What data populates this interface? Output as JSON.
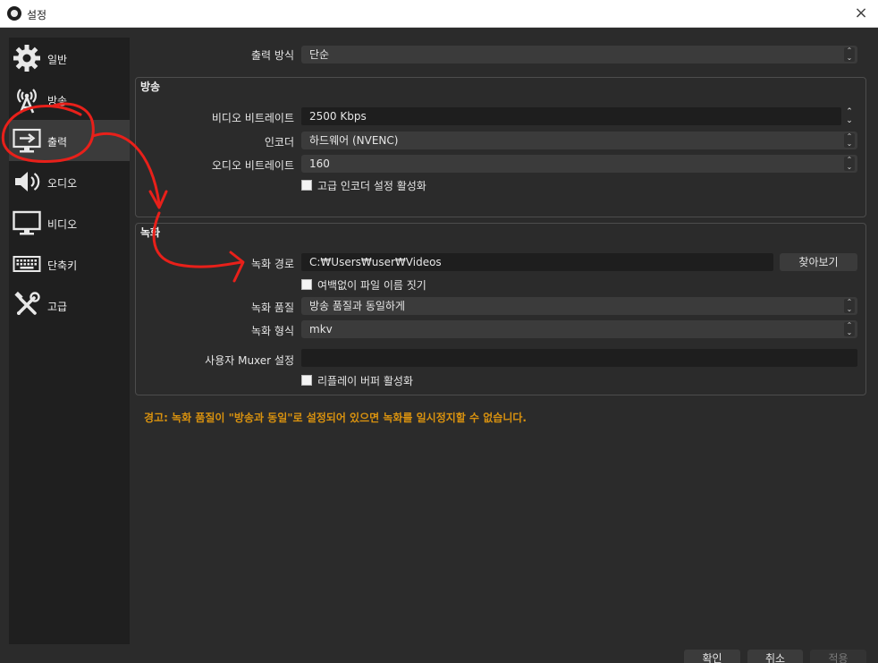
{
  "window": {
    "title": "설정",
    "app_icon": "obs-logo-icon",
    "close_label": "×"
  },
  "sidebar": {
    "items": [
      {
        "label": "일반",
        "icon": "gear-icon"
      },
      {
        "label": "방송",
        "icon": "broadcast-antenna-icon"
      },
      {
        "label": "출력",
        "icon": "output-monitor-icon",
        "active": true
      },
      {
        "label": "오디오",
        "icon": "speaker-icon"
      },
      {
        "label": "비디오",
        "icon": "monitor-icon"
      },
      {
        "label": "단축키",
        "icon": "keyboard-icon"
      },
      {
        "label": "고급",
        "icon": "tools-icon"
      }
    ]
  },
  "output_mode": {
    "label": "출력 방식",
    "value": "단순"
  },
  "streaming": {
    "title": "방송",
    "video_bitrate": {
      "label": "비디오 비트레이트",
      "value": "2500 Kbps"
    },
    "encoder": {
      "label": "인코더",
      "value": "하드웨어 (NVENC)"
    },
    "audio_bitrate": {
      "label": "오디오 비트레이트",
      "value": "160"
    },
    "advanced_encoder": {
      "label": "고급 인코더 설정 활성화",
      "checked": false
    }
  },
  "recording": {
    "title": "녹화",
    "path": {
      "label": "녹화 경로",
      "value": "C:₩Users₩user₩Videos",
      "browse_label": "찾아보기"
    },
    "no_space_filename": {
      "label": "여백없이 파일 이름 짓기",
      "checked": false
    },
    "quality": {
      "label": "녹화 품질",
      "value": "방송 품질과 동일하게"
    },
    "format": {
      "label": "녹화 형식",
      "value": "mkv"
    },
    "custom_muxer": {
      "label": "사용자 Muxer 설정",
      "value": ""
    },
    "replay_buffer": {
      "label": "리플레이 버퍼 활성화",
      "checked": false
    }
  },
  "warning": "경고: 녹화 품질이 \"방송과 동일\"로 설정되어 있으면 녹화를 일시정지할 수 없습니다.",
  "footer": {
    "ok_label": "확인",
    "cancel_label": "취소",
    "apply_label": "적용"
  },
  "colors": {
    "background": "#2b2b2b",
    "sidebar": "#1f1f1f",
    "warning": "#d9920f",
    "annotation": "#e8201a"
  }
}
